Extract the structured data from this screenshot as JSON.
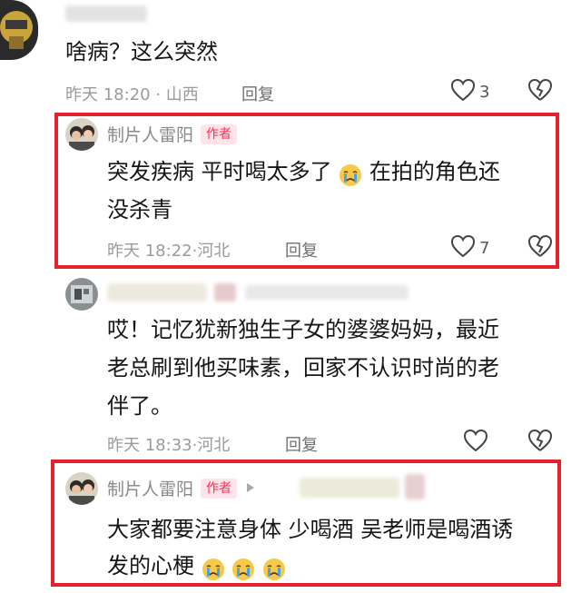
{
  "comments": [
    {
      "text": "啥病？这么突然",
      "time": "昨天 18:20",
      "location": "山西",
      "reply": "回复",
      "likes": "3"
    },
    {
      "author": "制片人雷阳",
      "badge": "作者",
      "text_line1": "突发疾病 平时喝太多了",
      "text_line1b": "在拍的角色还",
      "text_line2": "没杀青",
      "time": "昨天 18:22",
      "location": "河北",
      "reply": "回复",
      "likes": "7"
    },
    {
      "text_line1": "哎！记忆犹新独生子女的婆婆妈妈，最近",
      "text_line2": "老总刷到他买味素，回家不认识时尚的老",
      "text_line3": "伴了。",
      "time": "昨天 18:33",
      "location": "河北",
      "reply": "回复"
    },
    {
      "author": "制片人雷阳",
      "badge": "作者",
      "text_line1": "大家都要注意身体 少喝酒 吴老师是喝酒诱",
      "text_line2": "发的心梗"
    }
  ],
  "icons": {
    "like": "heart-outline-icon",
    "dislike": "broken-heart-icon",
    "emoji": "crying-face-emoji",
    "arrow": "play-arrow-icon"
  },
  "colors": {
    "highlight_border": "#e5222c",
    "author_badge_text": "#fe2c55",
    "author_badge_bg": "#ffe3e8",
    "meta_text": "#9b9b9b"
  }
}
